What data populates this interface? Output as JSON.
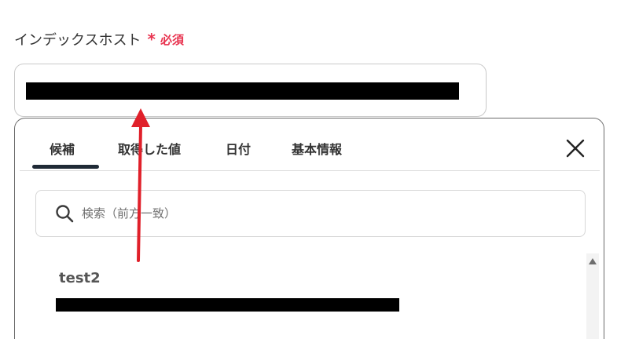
{
  "field": {
    "label": "インデックスホスト",
    "required_mark": "*",
    "required_text": "必須"
  },
  "popup": {
    "tabs": [
      {
        "label": "候補",
        "active": true
      },
      {
        "label": "取得した値",
        "active": false
      },
      {
        "label": "日付",
        "active": false
      },
      {
        "label": "基本情報",
        "active": false
      }
    ],
    "close_icon": "close-icon",
    "search": {
      "placeholder": "検索（前方一致）",
      "icon": "search-icon"
    },
    "results": [
      {
        "title": "test2"
      }
    ]
  },
  "colors": {
    "required": "#e8334f",
    "annotation_arrow": "#e0202a",
    "tab_underline": "#1f2a36"
  }
}
